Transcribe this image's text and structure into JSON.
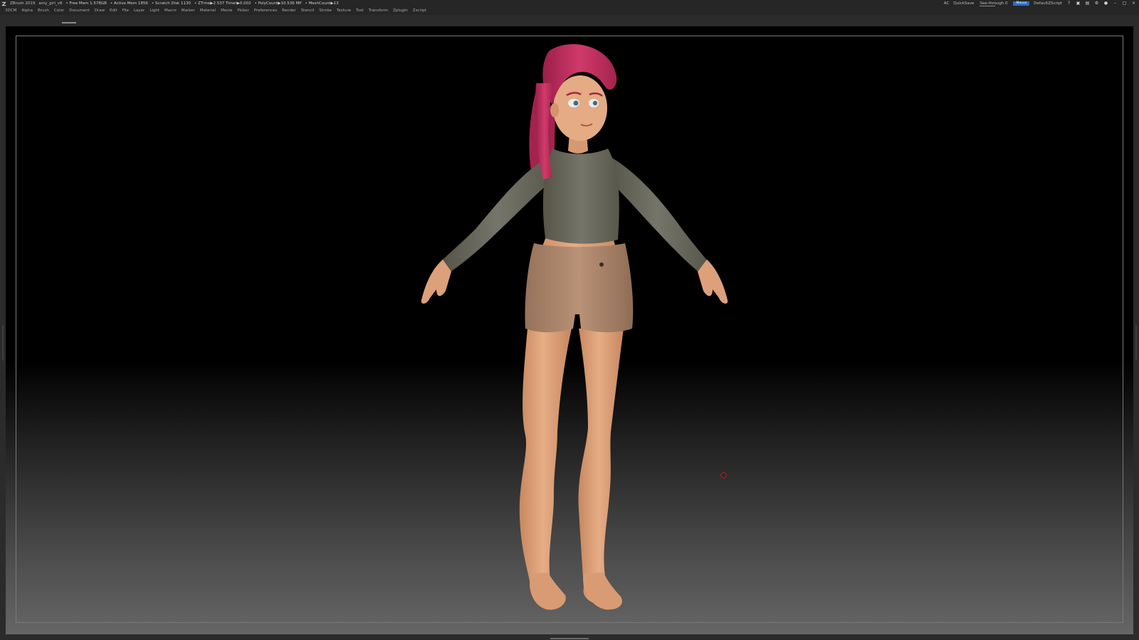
{
  "titlebar": {
    "app": "ZBrush 2019",
    "file": "amy_girl_v8",
    "stats": [
      "• Free Mem 1.578GB",
      "• Active Mem 1856",
      "• Scratch Disk 1130",
      "• ZTime▶2.537 Timer▶0.002",
      "• PolyCount▶10.536 MP",
      "• MeshCount▶13"
    ],
    "ac": "AC",
    "quicksave": "QuickSave",
    "see_through_label": "See-through  0",
    "see_through_value": 0,
    "menus_button": "Menus",
    "script": "DefaultZScript"
  },
  "menubar": {
    "items": [
      "3DCM",
      "Alpha",
      "Brush",
      "Color",
      "Document",
      "Draw",
      "Edit",
      "File",
      "Layer",
      "Light",
      "Macro",
      "Marker",
      "Material",
      "Movie",
      "Picker",
      "Preferences",
      "Render",
      "Stencil",
      "Stroke",
      "Texture",
      "Tool",
      "Transform",
      "Zplugin",
      "Zscript"
    ]
  },
  "colors": {
    "hair": "#c2305f",
    "skin": "#e2a77f",
    "shirt": "#6f6e60",
    "shorts": "#b48b6e",
    "accent": "#2f6fc4"
  },
  "icons": [
    "zbrush-logo-icon",
    "help-icon",
    "window-icon",
    "layout-icon",
    "settings-icon",
    "lock-icon",
    "minimize-icon",
    "restore-icon",
    "close-icon"
  ]
}
